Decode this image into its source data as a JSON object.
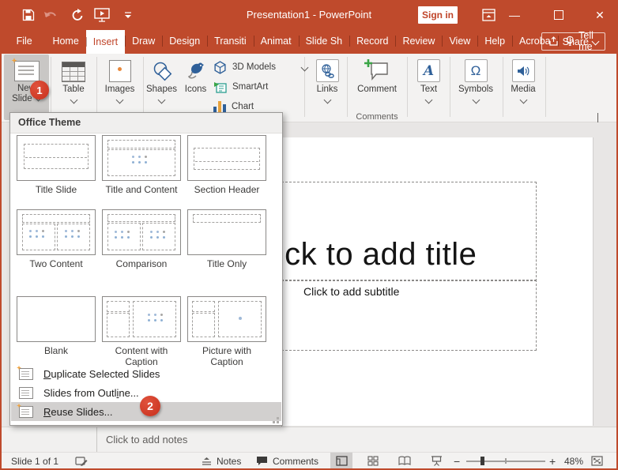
{
  "window": {
    "title": "Presentation1  -  PowerPoint"
  },
  "titlebar": {
    "sign_in": "Sign in"
  },
  "ribbon_tabs": {
    "items": [
      "File",
      "Home",
      "Insert",
      "Draw",
      "Design",
      "Transiti",
      "Animat",
      "Slide Sh",
      "Record",
      "Review",
      "View",
      "Help",
      "Acroba"
    ],
    "active": "Insert",
    "tell_me": "Tell me",
    "share": "Share"
  },
  "ribbon": {
    "new_slide_line1": "New",
    "new_slide_line2": "Slide",
    "table": "Table",
    "images": "Images",
    "shapes": "Shapes",
    "icons": "Icons",
    "models_3d": "3D Models",
    "smartart": "SmartArt",
    "chart": "Chart",
    "links": "Links",
    "comment": "Comment",
    "text": "Text",
    "symbols": "Symbols",
    "media": "Media",
    "comments_group_label": "Comments"
  },
  "annotations": {
    "step1": "1",
    "step2": "2"
  },
  "dropdown": {
    "header": "Office Theme",
    "layouts": [
      "Title Slide",
      "Title and Content",
      "Section Header",
      "Two Content",
      "Comparison",
      "Title Only",
      "Blank",
      "Content with Caption",
      "Picture with Caption"
    ],
    "menu": [
      {
        "pre": "",
        "key": "D",
        "post": "uplicate Selected Slides"
      },
      {
        "pre": "Slides from Outl",
        "key": "i",
        "post": "ne..."
      },
      {
        "pre": "",
        "key": "R",
        "post": "euse Slides..."
      }
    ]
  },
  "slide": {
    "title_placeholder": "Click to add title",
    "subtitle_placeholder": "Click to add subtitle"
  },
  "notes": {
    "placeholder": "Click to add notes"
  },
  "statusbar": {
    "slide_indicator": "Slide 1 of 1",
    "notes_label": "Notes",
    "comments_label": "Comments",
    "zoom_level": "48%"
  },
  "icons": {
    "text_glyph": "A",
    "symbols_glyph": "Ω",
    "save-icon": "floppy",
    "undo-icon": "curved-arrow-left (disabled)",
    "redo-icon": "circular-arrow",
    "slideshow-icon": "monitor-with-play",
    "qat-chevron-icon": "bar-over-triangle",
    "ribbon-display-options-icon": "window-with-up-arrow",
    "lightbulb-icon": "bulb",
    "share-icon": "box-with-up-arrow",
    "links-icon": "globe-chain",
    "comment-add-icon": "speech-bubble-plus",
    "media-icon": "speaker",
    "3d-models-icon": "cube",
    "smartart-icon": "teal-list-arrow",
    "chart-icon": "bar-chart",
    "shapes-icon": "circle-and-diamond",
    "icons-icon": "bird-leaf"
  },
  "colors": {
    "brand_red": "#bf4a2c",
    "annotation_red": "#d03a28",
    "icon_blue": "#2f6099",
    "ribbon_bg": "#f3f2f1"
  }
}
